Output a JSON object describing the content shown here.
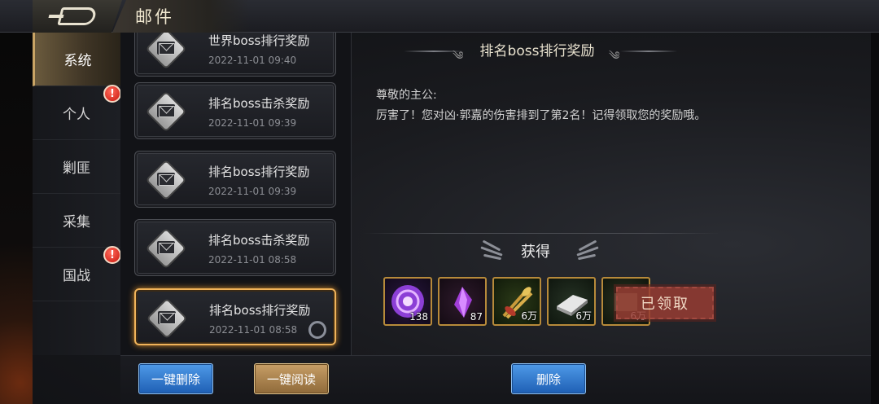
{
  "header": {
    "title": "邮件",
    "back_icon": "back-arrow-icon"
  },
  "sidebar": {
    "items": [
      {
        "label": "系统",
        "active": true,
        "badge": ""
      },
      {
        "label": "个人",
        "active": false,
        "badge": "!"
      },
      {
        "label": "剿匪",
        "active": false,
        "badge": ""
      },
      {
        "label": "采集",
        "active": false,
        "badge": ""
      },
      {
        "label": "国战",
        "active": false,
        "badge": "!"
      }
    ]
  },
  "mails": [
    {
      "subject": "世界boss排行奖励",
      "date": "2022-11-01   09:40",
      "selected": false
    },
    {
      "subject": "排名boss击杀奖励",
      "date": "2022-11-01   09:39",
      "selected": false
    },
    {
      "subject": "排名boss排行奖励",
      "date": "2022-11-01   09:39",
      "selected": false
    },
    {
      "subject": "排名boss击杀奖励",
      "date": "2022-11-01   08:58",
      "selected": false
    },
    {
      "subject": "排名boss排行奖励",
      "date": "2022-11-01   08:58",
      "selected": true
    }
  ],
  "detail": {
    "title": "排名boss排行奖励",
    "greeting": "尊敬的主公:",
    "body": "厉害了！您对凶·郭嘉的伤害排到了第2名！记得领取您的奖励哦。",
    "obtain_label": "获得",
    "rewards": [
      {
        "icon": "purple-orb-icon",
        "count": "138"
      },
      {
        "icon": "purple-crystal-icon",
        "count": "87"
      },
      {
        "icon": "wheat-bundle-icon",
        "count": "6万"
      },
      {
        "icon": "silver-ingot-icon",
        "count": "6万"
      },
      {
        "icon": "reward-item-icon",
        "count": "6万"
      }
    ],
    "claimed_stamp": "已领取"
  },
  "buttons": {
    "delete_all": "一键删除",
    "read_all": "一键阅读",
    "delete": "删除"
  },
  "colors": {
    "accent_gold": "#c9a465",
    "button_blue": "#2e74cc",
    "button_gold": "#a8814c",
    "stamp_red": "#963c32"
  }
}
